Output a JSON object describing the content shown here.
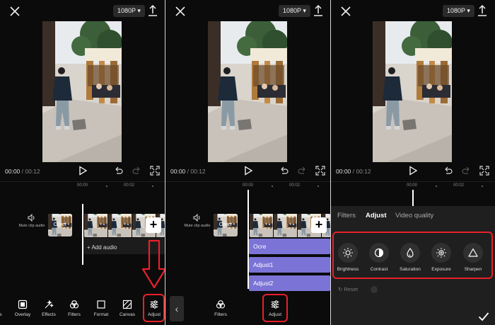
{
  "app": {
    "resolution_label": "1080P",
    "current_time": "00:00",
    "total_time": "/ 00:12",
    "ruler_start": "00:00",
    "ruler_mark": "00:02"
  },
  "timeline": {
    "mute_label": "Mute clip audio",
    "cover_label": "Cover",
    "add_clip_symbol": "+",
    "add_audio_label": "+ Add audio"
  },
  "panel1": {
    "toolbar": [
      {
        "label": "s",
        "icon": "partial-tool-icon"
      },
      {
        "label": "Overlay",
        "icon": "overlay-icon"
      },
      {
        "label": "Effects",
        "icon": "effects-icon"
      },
      {
        "label": "Filters",
        "icon": "filters-icon"
      },
      {
        "label": "Format",
        "icon": "format-icon"
      },
      {
        "label": "Canvas",
        "icon": "canvas-icon"
      },
      {
        "label": "Adjust",
        "icon": "adjust-icon"
      }
    ]
  },
  "panel2": {
    "tracks": [
      "Ocre",
      "Adjust1",
      "Adjust2"
    ],
    "back_symbol": "‹",
    "toolbar": [
      {
        "label": "Filters",
        "icon": "filters-icon"
      },
      {
        "label": "Adjust",
        "icon": "adjust-icon"
      }
    ]
  },
  "panel3": {
    "tabs": [
      "Filters",
      "Adjust",
      "Video quality"
    ],
    "active_tab": "Adjust",
    "options": [
      {
        "label": "Brightness",
        "icon": "brightness-icon"
      },
      {
        "label": "Contrast",
        "icon": "contrast-icon"
      },
      {
        "label": "Saturation",
        "icon": "saturation-icon"
      },
      {
        "label": "Exposure",
        "icon": "exposure-icon"
      },
      {
        "label": "Sharpen",
        "icon": "sharpen-icon"
      }
    ],
    "reset_label": "Reset"
  },
  "colors": {
    "accent_purple": "#7b74d6",
    "highlight_red": "#e8202a",
    "background": "#0b0b0b"
  }
}
